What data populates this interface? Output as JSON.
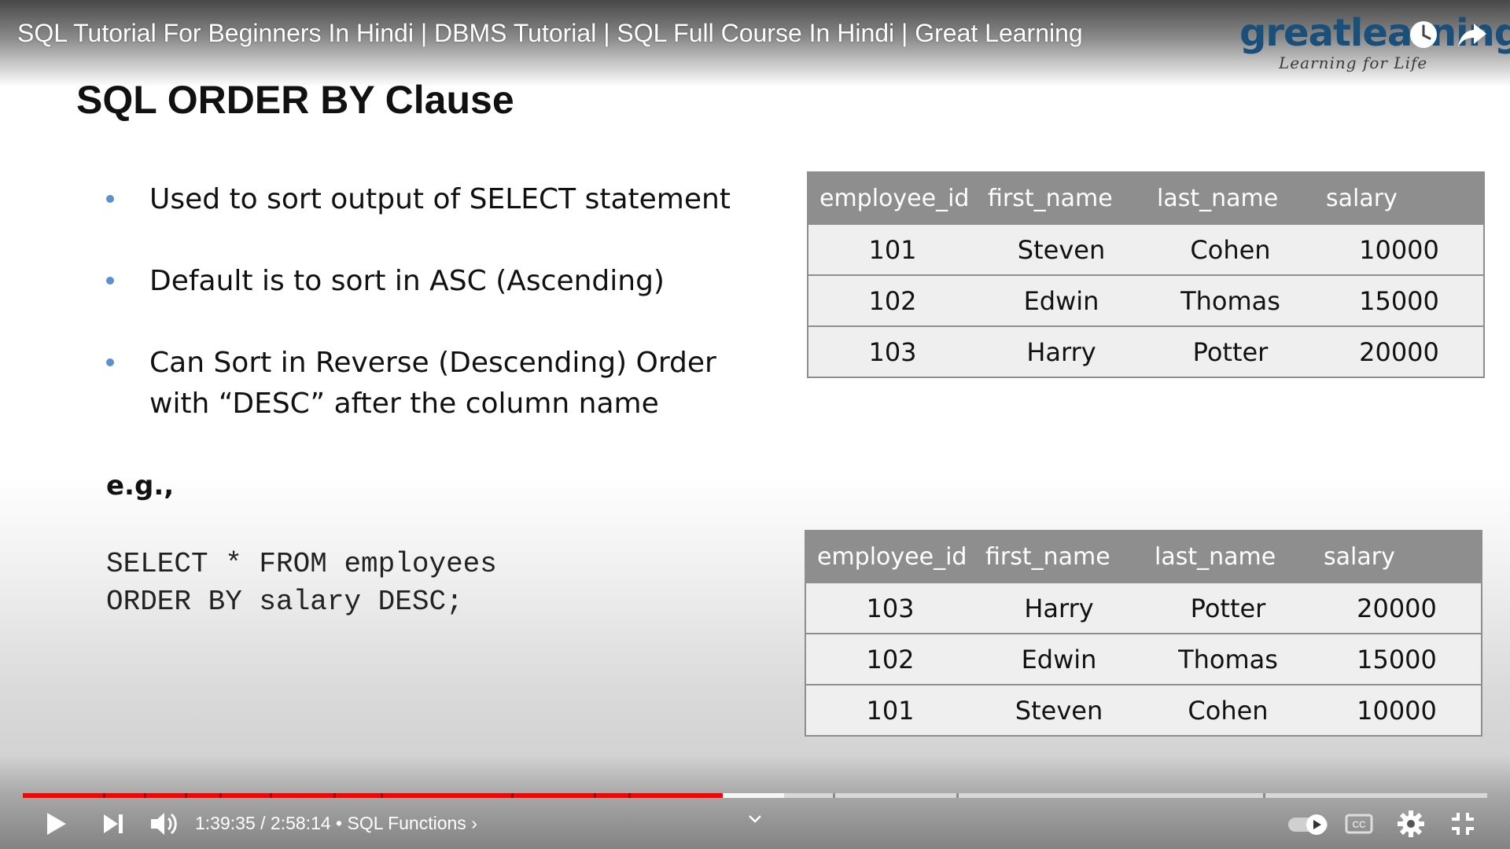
{
  "video": {
    "title": "SQL Tutorial For Beginners In Hindi | DBMS Tutorial | SQL Full Course In Hindi | Great Learning",
    "logo_word": "greatlearning",
    "logo_tagline": "Learning for Life"
  },
  "slide": {
    "title": "SQL ORDER BY Clause",
    "bullets": [
      "Used to sort output of SELECT statement",
      "Default is to sort in ASC (Ascending)",
      "Can Sort in Reverse (Descending) Order with “DESC” after the column name"
    ],
    "eg_label": "e.g.,",
    "code_line1": "SELECT * FROM employees",
    "code_line2": "ORDER BY salary DESC;",
    "table_headers": [
      "employee_id",
      "first_name",
      "last_name",
      "salary"
    ],
    "table1_rows": [
      [
        "101",
        "Steven",
        "Cohen",
        "10000"
      ],
      [
        "102",
        "Edwin",
        "Thomas",
        "15000"
      ],
      [
        "103",
        "Harry",
        "Potter",
        "20000"
      ]
    ],
    "table2_rows": [
      [
        "103",
        "Harry",
        "Potter",
        "20000"
      ],
      [
        "102",
        "Edwin",
        "Thomas",
        "15000"
      ],
      [
        "101",
        "Steven",
        "Cohen",
        "10000"
      ]
    ]
  },
  "player": {
    "current_time": "1:39:35",
    "separator": " / ",
    "duration": "2:58:14",
    "chapter_sep": " • ",
    "chapter": "SQL Functions",
    "chapter_chevron": "›",
    "progress_fraction": 0.478,
    "buffer_fraction": 0.52,
    "accent_color": "#ff0000",
    "icons": [
      "play-icon",
      "next-icon",
      "volume-icon",
      "autoplay-toggle-icon",
      "captions-icon",
      "settings-icon",
      "exit-fullscreen-icon",
      "watch-later-icon",
      "share-icon",
      "chevron-down-icon"
    ]
  }
}
